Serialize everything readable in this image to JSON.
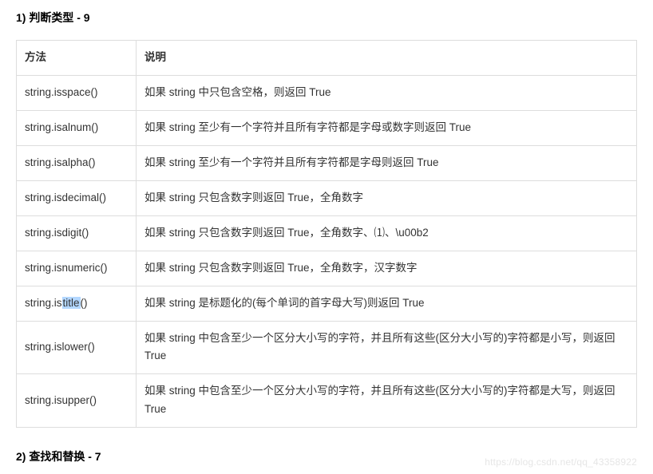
{
  "section1": {
    "title": "1) 判断类型 - 9",
    "headers": {
      "method": "方法",
      "description": "说明"
    },
    "rows": [
      {
        "method": "string.isspace()",
        "desc": "如果 string 中只包含空格，则返回 True"
      },
      {
        "method": "string.isalnum()",
        "desc": "如果 string 至少有一个字符并且所有字符都是字母或数字则返回 True"
      },
      {
        "method": "string.isalpha()",
        "desc": "如果 string 至少有一个字符并且所有字符都是字母则返回 True"
      },
      {
        "method": "string.isdecimal()",
        "desc": "如果 string 只包含数字则返回 True，全角数字"
      },
      {
        "method": "string.isdigit()",
        "desc": "如果 string 只包含数字则返回 True，全角数字、⑴、\\u00b2"
      },
      {
        "method": "string.isnumeric()",
        "desc": "如果 string 只包含数字则返回 True，全角数字，汉字数字"
      },
      {
        "method_prefix": "string.is",
        "method_highlight": "title",
        "method_suffix": "()",
        "desc": "如果 string 是标题化的(每个单词的首字母大写)则返回 True"
      },
      {
        "method": "string.islower()",
        "desc": "如果 string 中包含至少一个区分大小写的字符，并且所有这些(区分大小写的)字符都是小写，则返回 True"
      },
      {
        "method": "string.isupper()",
        "desc": "如果 string 中包含至少一个区分大小写的字符，并且所有这些(区分大小写的)字符都是大写，则返回 True"
      }
    ]
  },
  "section2": {
    "title": "2) 查找和替换 - 7"
  },
  "watermark": "https://blog.csdn.net/qq_43358922"
}
